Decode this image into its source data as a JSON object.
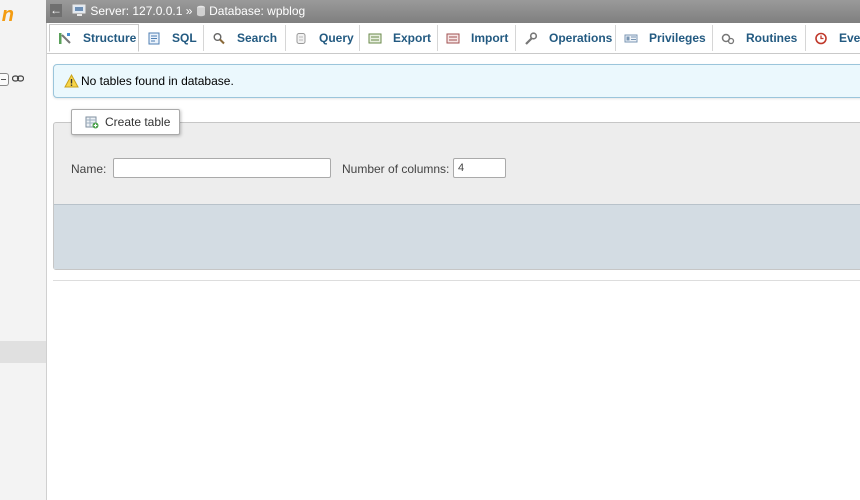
{
  "nav": {
    "logo_fragment": "n"
  },
  "topbar": {
    "back_glyph": "←",
    "server_label": "Server: 127.0.0.1",
    "separator": "»",
    "database_label": "Database: wpblog"
  },
  "tabs": [
    {
      "label": "Structure",
      "icon": "structure-icon",
      "active": true
    },
    {
      "label": "SQL",
      "icon": "sql-icon"
    },
    {
      "label": "Search",
      "icon": "search-icon"
    },
    {
      "label": "Query",
      "icon": "query-icon"
    },
    {
      "label": "Export",
      "icon": "export-icon"
    },
    {
      "label": "Import",
      "icon": "import-icon"
    },
    {
      "label": "Operations",
      "icon": "wrench-icon"
    },
    {
      "label": "Privileges",
      "icon": "privileges-icon"
    },
    {
      "label": "Routines",
      "icon": "routines-icon"
    },
    {
      "label": "Eve",
      "icon": "clock-icon"
    }
  ],
  "notice": {
    "message": "No tables found in database."
  },
  "create_table": {
    "legend": "Create table",
    "name_label": "Name:",
    "name_value": "",
    "columns_label": "Number of columns:",
    "columns_value": "4"
  },
  "colors": {
    "tab_text": "#235a81",
    "notice_bg": "#ebf8fd",
    "footer_bg": "#d3dce3"
  }
}
